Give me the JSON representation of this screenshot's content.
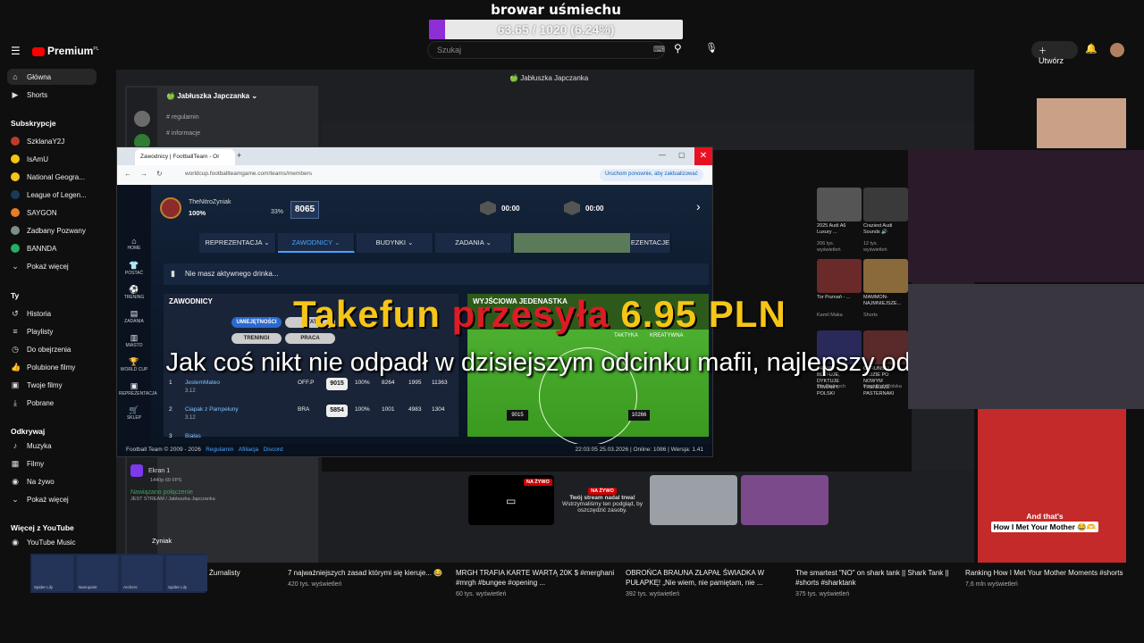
{
  "overlay": {
    "title": "browar uśmiechu",
    "progress_text": "63.65 / 1020 (6.24%)",
    "progress_fraction": 0.0624
  },
  "masthead": {
    "logo_text": "Premium",
    "logo_sup": "PL",
    "search_placeholder": "Szukaj",
    "create_label": "Utwórz"
  },
  "sidebar": {
    "items": [
      {
        "label": "Główna",
        "icon": "home-icon",
        "active": true
      },
      {
        "label": "Shorts",
        "icon": "shorts-icon"
      }
    ],
    "subs_header": "Subskrypcje",
    "subs": [
      {
        "label": "SzklanaY2J",
        "color": "#c0392b"
      },
      {
        "label": "IsAmU",
        "color": "#f1c40f"
      },
      {
        "label": "National Geogra...",
        "color": "#f5c518"
      },
      {
        "label": "League of Legen...",
        "color": "#1a3a5c"
      },
      {
        "label": "SAYGON",
        "color": "#e67e22"
      },
      {
        "label": "Zadbany Pozwany",
        "color": "#7f8c8d"
      },
      {
        "label": "BANNDA",
        "color": "#27ae60"
      }
    ],
    "show_more": "Pokaż więcej",
    "you_header": "Ty",
    "you_items": [
      {
        "label": "Historia",
        "icon": "history-icon"
      },
      {
        "label": "Playlisty",
        "icon": "playlist-icon"
      },
      {
        "label": "Do obejrzenia",
        "icon": "clock-icon"
      },
      {
        "label": "Polubione filmy",
        "icon": "thumb-up-icon"
      },
      {
        "label": "Twoje filmy",
        "icon": "video-icon"
      },
      {
        "label": "Pobrane",
        "icon": "download-icon"
      }
    ],
    "explore_header": "Odkrywaj",
    "explore_items": [
      {
        "label": "Muzyka",
        "icon": "music-icon"
      },
      {
        "label": "Filmy",
        "icon": "film-icon"
      },
      {
        "label": "Na żywo",
        "icon": "live-icon"
      },
      {
        "label": "Pokaż więcej",
        "icon": "chevron-down-icon"
      }
    ],
    "more_header": "Więcej z YouTube",
    "more_items": [
      {
        "label": "YouTube Music"
      }
    ]
  },
  "discord": {
    "window_title": "Jabłuszka Japczanka",
    "server_name": "Jabłuszka Japczanka",
    "channels": [
      "regulamin",
      "informacje"
    ],
    "screen_label": "Ekran 1",
    "screen_sub": "1440p 60 FPS",
    "connected": "Nawiązano połączenie",
    "connected_sub": "JEST STREAM / Jabłuszka Japczanka",
    "user": "Zyniak"
  },
  "browser": {
    "tab_title": "Zawodnicy | FootballTeam - Or",
    "url": "worldcup.footballteamgame.com/teams/members",
    "update_pill": "Uruchom ponownie, aby zaktualizować"
  },
  "game": {
    "player_name": "TheNitroZyniak",
    "player_pct": "100%",
    "energy": "33%",
    "score": "8065",
    "timer1": "00:00",
    "timer2": "00:00",
    "nav": [
      {
        "label": "HOME",
        "icon": "home-icon"
      },
      {
        "label": "POSTAĆ",
        "icon": "shirt-icon"
      },
      {
        "label": "TRENING",
        "icon": "ball-icon"
      },
      {
        "label": "ZADANIA",
        "icon": "task-icon"
      },
      {
        "label": "MIASTO",
        "icon": "city-icon"
      },
      {
        "label": "WORLD CUP",
        "icon": "trophy-icon"
      },
      {
        "label": "REPREZENTACJA",
        "icon": "team-icon"
      },
      {
        "label": "SKLEP",
        "icon": "cart-icon"
      }
    ],
    "menu": [
      "REPREZENTACJA",
      "ZAWODNICY",
      "BUDYNKI",
      "ZADANIA",
      "EZENTACJE"
    ],
    "drink_notice": "Nie masz aktywnego drinka...",
    "players_header": "ZAWODNICY",
    "lineup_header": "WYJŚCIOWA JEDENASTKA",
    "pills": [
      "UMIEJĘTNOŚCI",
      "STAT",
      "TRENINGI",
      "PRACA"
    ],
    "lineup_tabs": [
      "TAKTYKA",
      "KREATYWNA"
    ],
    "players": [
      {
        "num": "1",
        "name": "JestemMateo",
        "pos": "OFF.P",
        "ovr": "9015",
        "pct": "100%",
        "a": "8264",
        "b": "1995",
        "c": "11363",
        "sub": "3.12"
      },
      {
        "num": "2",
        "name": "Ciapak z Pampeluny",
        "pos": "BRA",
        "ovr": "5854",
        "pct": "100%",
        "a": "1001",
        "b": "4983",
        "c": "1304",
        "sub": "3.12"
      },
      {
        "num": "3",
        "name": "Białas",
        "pos": "",
        "ovr": "",
        "pct": "",
        "a": "",
        "b": "",
        "c": "",
        "sub": ""
      }
    ],
    "pitch_ovr": [
      "9015",
      "10266"
    ],
    "footer_left": "Football Team © 2009 - 2026",
    "footer_links": [
      "Regulamin",
      "Afiliacja",
      "Discord"
    ],
    "footer_right": "22:03:05 25.03.2026 | Online: 1086 | Wersja: 1.41"
  },
  "donation": {
    "name": "Takefun",
    "verb": "przesyła",
    "amount": "6.95",
    "currency": "PLN"
  },
  "caption": "Jak coś nikt nie odpadł w dzisiejszym odcinku mafii, najlepszy odcinek.",
  "short_caption": [
    "And that's",
    "How I Met Your Mother 😂🫶"
  ],
  "live": {
    "badge": "NA ŻYWO",
    "message_title": "Twój stream nadal trwa!",
    "message_body": "Wstrzymaliśmy ten podgląd, by oszczędzić zasoby."
  },
  "right_col": [
    {
      "title": "2025 Audi A6 Luxury ...",
      "meta": "206 tys. wyświetleń"
    },
    {
      "title": "Craziest Audi Sounds 🔊",
      "meta": "12 tys. wyświetleń"
    },
    {
      "title": "Tor Poznań - ...",
      "meta": "Kamil Maka"
    },
    {
      "title": "MAMMON- NAJMNIEJSZE...",
      "meta": "Shorts"
    },
    {
      "title": "TRUMP BLEFUJE, DYKTUJE TRWAMY POLSKI",
      "meta": "Dla Pięknych"
    },
    {
      "title": "OKRUŃSKI JEDZIE PO NOWYM TRENERZE PASTERNAKI",
      "meta": "FreakFightPolska"
    }
  ],
  "bottom_videos": [
    {
      "title": "Żurnalisty",
      "meta": ""
    },
    {
      "title": "7 najważniejszych zasad którymi się kieruje... 😂",
      "meta": "420 tys. wyświetleń"
    },
    {
      "title": "MRGH TRAFIA KARTE WARTĄ 20K $ #merghani #mrgh #bungee #opening ...",
      "meta": "60 tys. wyświetleń"
    },
    {
      "title": "OBROŃCA BRAUNA ZŁAPAŁ ŚWIADKA W PUŁAPKĘ! „Nie wiem, nie pamiętam, nie ...",
      "meta": "392 tys. wyświetleń"
    },
    {
      "title": "The smartest \"NO\" on shark tank || Shark Tank || #shorts #sharktank",
      "meta": "375 tys. wyświetleń"
    },
    {
      "title": "Ranking How I Met Your Mother Moments #shorts",
      "meta": "7,6 mln wyświetleń"
    }
  ],
  "items_strip": [
    "Spider Lily",
    "Nanopaint",
    "Archers",
    "Spider Lily"
  ],
  "colors": {
    "accent": "#8e2fd6",
    "donation_yellow": "#f5c518",
    "donation_red": "#e01b24",
    "close": "#e81123"
  }
}
